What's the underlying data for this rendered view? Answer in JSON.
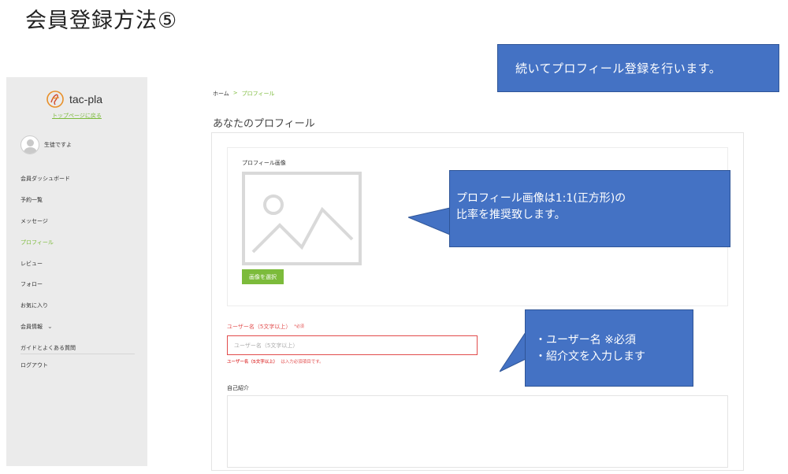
{
  "slide": {
    "title": "会員登録方法⑤"
  },
  "sidebar": {
    "logo_text": "tac-pla",
    "top_link": "トップページに戻る",
    "user_name": "生徒ですよ",
    "items": [
      {
        "label": "会員ダッシュボード"
      },
      {
        "label": "予約一覧"
      },
      {
        "label": "メッセージ"
      },
      {
        "label": "プロフィール"
      },
      {
        "label": "レビュー"
      },
      {
        "label": "フォロー"
      },
      {
        "label": "お気に入り"
      },
      {
        "label": "会員情報"
      },
      {
        "label": "ガイドとよくある質問"
      },
      {
        "label": "ログアウト"
      }
    ]
  },
  "breadcrumb": {
    "home": "ホーム",
    "separator": ">",
    "current": "プロフィール"
  },
  "page": {
    "title": "あなたのプロフィール"
  },
  "form": {
    "image_label": "プロフィール画像",
    "select_image_button": "画像を選択",
    "username_label": "ユーザー名（5文字以上）",
    "username_required": "*必須",
    "username_placeholder": "ユーザー名（5文字以上）",
    "username_error_bold": "ユーザー名（5文字以上）",
    "username_error_rest": "は入力必須項目です。",
    "bio_label": "自己紹介"
  },
  "callouts": {
    "intro": "続いてプロフィール登録を行います。",
    "image_line1": "プロフィール画像は1:1(正方形)の",
    "image_line2": "比率を推奨致します。",
    "fields_line1": "・ユーザー名 ※必須",
    "fields_line2": "・紹介文を入力します"
  },
  "colors": {
    "accent_green": "#7cbb3b",
    "error_red": "#e24c4c",
    "callout_blue": "#4472c4"
  }
}
